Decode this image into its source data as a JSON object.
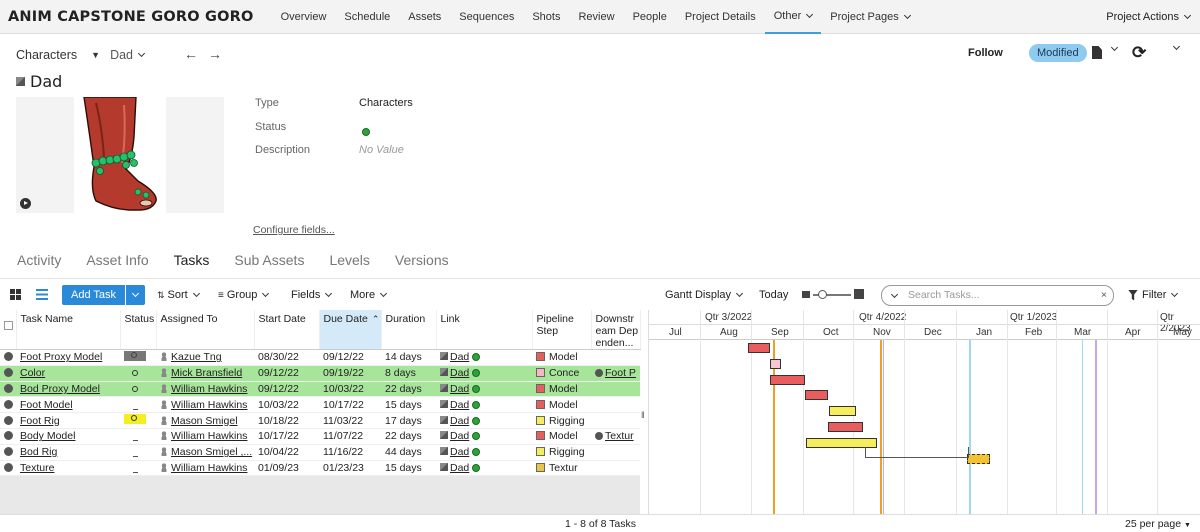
{
  "nav": {
    "project": "ANIM CAPSTONE GORO GORO",
    "items": [
      {
        "label": "Overview"
      },
      {
        "label": "Schedule"
      },
      {
        "label": "Assets"
      },
      {
        "label": "Sequences"
      },
      {
        "label": "Shots"
      },
      {
        "label": "Review"
      },
      {
        "label": "People"
      },
      {
        "label": "Project Details"
      },
      {
        "label": "Other"
      },
      {
        "label": "Project Pages"
      }
    ],
    "active": "Other",
    "actions": "Project Actions"
  },
  "header": {
    "crumb_type": "Characters",
    "crumb_entity": "Dad",
    "follow": "Follow",
    "status_badge": "Modified",
    "refresh_glyph": "⟳",
    "title": "Dad"
  },
  "fields": {
    "type_label": "Type",
    "type_value": "Characters",
    "status_label": "Status",
    "description_label": "Description",
    "description_value": "No Value",
    "configure": "Configure fields..."
  },
  "tabs": [
    "Activity",
    "Asset Info",
    "Tasks",
    "Sub Assets",
    "Levels",
    "Versions"
  ],
  "active_tab": "Tasks",
  "toolbar": {
    "add_task": "Add Task",
    "sort": "Sort",
    "group": "Group",
    "fields": "Fields",
    "more": "More",
    "gantt_display": "Gantt Display",
    "today": "Today",
    "search_placeholder": "Search Tasks...",
    "clear": "×",
    "filter": "Filter"
  },
  "grid": {
    "columns": [
      "Task Name",
      "Status",
      "Assigned To",
      "Start Date",
      "Due Date",
      "Duration",
      "Link",
      "Pipeline Step",
      "Downstream Dependen..."
    ],
    "rows": [
      {
        "name": "Foot Proxy Model",
        "status": "fin",
        "assigned": "Kazue Tng",
        "start": "08/30/22",
        "due": "09/12/22",
        "duration": "14 days",
        "link": "Dad",
        "step": "Model",
        "step_color": "#e85d5d",
        "downstream": ""
      },
      {
        "name": "Color",
        "status": "ip",
        "assigned": "Mick Bransfield",
        "start": "09/12/22",
        "due": "09/19/22",
        "duration": "8 days",
        "link": "Dad",
        "step": "Conce",
        "step_color": "#f7b6c3",
        "downstream": "Foot P"
      },
      {
        "name": "Bod Proxy Model",
        "status": "ip",
        "assigned": "William Hawkins",
        "start": "09/12/22",
        "due": "10/03/22",
        "duration": "22 days",
        "link": "Dad",
        "step": "Model",
        "step_color": "#e85d5d",
        "downstream": ""
      },
      {
        "name": "Foot Model",
        "status": "wtg",
        "assigned": "William Hawkins",
        "start": "10/03/22",
        "due": "10/17/22",
        "duration": "15 days",
        "link": "Dad",
        "step": "Model",
        "step_color": "#e85d5d",
        "downstream": ""
      },
      {
        "name": "Foot Rig",
        "status": "rdy",
        "assigned": "Mason Smigel",
        "start": "10/18/22",
        "due": "11/03/22",
        "duration": "17 days",
        "link": "Dad",
        "step": "Rigging",
        "step_color": "#f5ee5a",
        "downstream": ""
      },
      {
        "name": "Body Model",
        "status": "wtg",
        "assigned": "William Hawkins",
        "start": "10/17/22",
        "due": "11/07/22",
        "duration": "22 days",
        "link": "Dad",
        "step": "Model",
        "step_color": "#e85d5d",
        "downstream": "Textur"
      },
      {
        "name": "Bod Rig",
        "status": "wtg",
        "assigned": "Mason Smigel ,...",
        "start": "10/04/22",
        "due": "11/16/22",
        "duration": "44 days",
        "link": "Dad",
        "step": "Rigging",
        "step_color": "#f5ee5a",
        "downstream": ""
      },
      {
        "name": "Texture",
        "status": "wtg",
        "assigned": "William Hawkins",
        "start": "01/09/23",
        "due": "01/23/23",
        "duration": "15 days",
        "link": "Dad",
        "step": "Textur",
        "step_color": "#e8c44a",
        "downstream": ""
      }
    ],
    "footer": "1 - 8 of 8 Tasks",
    "per_page": "25 per page"
  },
  "gantt": {
    "quarters": [
      "Qtr 3/2022",
      "Qtr 4/2022",
      "Qtr 1/2023",
      "Qtr 2/2023"
    ],
    "months": [
      "Jul",
      "Aug",
      "Sep",
      "Oct",
      "Nov",
      "Dec",
      "Jan",
      "Feb",
      "Mar",
      "Apr",
      "May"
    ]
  },
  "colors": {
    "accent": "#2b8ad8",
    "highlight_row": "#a7e59a",
    "today_line": "#f0a020",
    "badge": "#8fcbf0"
  }
}
